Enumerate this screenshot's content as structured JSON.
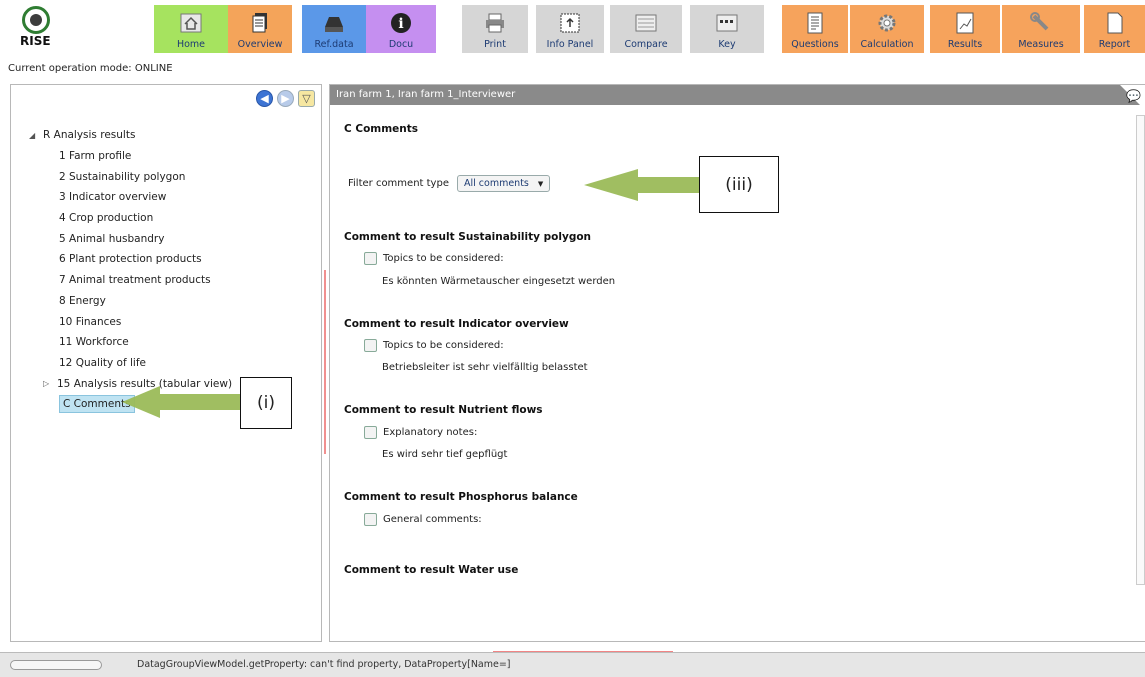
{
  "app": {
    "logo_text": "RISE",
    "mode_text": "Current operation mode: ONLINE"
  },
  "toolbar": {
    "buttons": [
      {
        "label": "Home"
      },
      {
        "label": "Overview"
      },
      {
        "label": "Ref.data"
      },
      {
        "label": "Docu"
      },
      {
        "label": "Print"
      },
      {
        "label": "Info Panel"
      },
      {
        "label": "Compare"
      },
      {
        "label": "Key"
      },
      {
        "label": "Questions"
      },
      {
        "label": "Calculation"
      },
      {
        "label": "Results"
      },
      {
        "label": "Measures"
      },
      {
        "label": "Report"
      }
    ]
  },
  "tree": {
    "root": "R Analysis results",
    "items": [
      "1 Farm profile",
      "2 Sustainability polygon",
      "3 Indicator overview",
      "4 Crop production",
      "5 Animal husbandry",
      "6 Plant protection products",
      "7 Animal treatment products",
      "8 Energy",
      "10 Finances",
      "11 Workforce",
      "12 Quality of life",
      "15 Analysis results (tabular view)",
      "C Comments"
    ]
  },
  "main": {
    "header": "Iran farm 1, Iran farm 1_Interviewer",
    "title": "C Comments",
    "filter_label": "Filter comment type",
    "filter_value": "All comments",
    "sections": [
      {
        "title": "Comment to result Sustainability polygon",
        "checkbox": "Topics to be considered:",
        "text": "Es könnten Wärmetauscher eingesetzt werden"
      },
      {
        "title": "Comment to result Indicator overview",
        "checkbox": "Topics to be considered:",
        "text": "Betriebsleiter ist sehr vielfälltig belasstet"
      },
      {
        "title": "Comment to result Nutrient flows",
        "checkbox": "Explanatory notes:",
        "text": "Es wird sehr tief gepflügt"
      },
      {
        "title": "Comment to result Phosphorus balance",
        "checkbox": "General comments:",
        "text": ""
      },
      {
        "title": "Comment to result Water use"
      }
    ]
  },
  "annotations": {
    "i": "(i)",
    "iii": "(iii)"
  },
  "status": {
    "message": "DatagGroupViewModel.getProperty: can't find property, DataProperty[Name=]"
  },
  "colors": {
    "arrow": "#9bbb59",
    "header": "#8a8a8a",
    "selection": "#bfe3f2"
  }
}
